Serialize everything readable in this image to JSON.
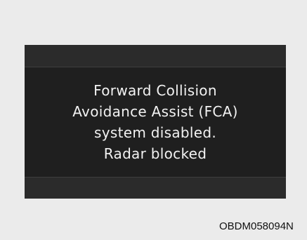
{
  "display": {
    "message_lines": [
      "Forward Collision",
      "Avoidance Assist (FCA)",
      "system disabled.",
      "Radar blocked"
    ]
  },
  "caption": "OBDM058094N"
}
